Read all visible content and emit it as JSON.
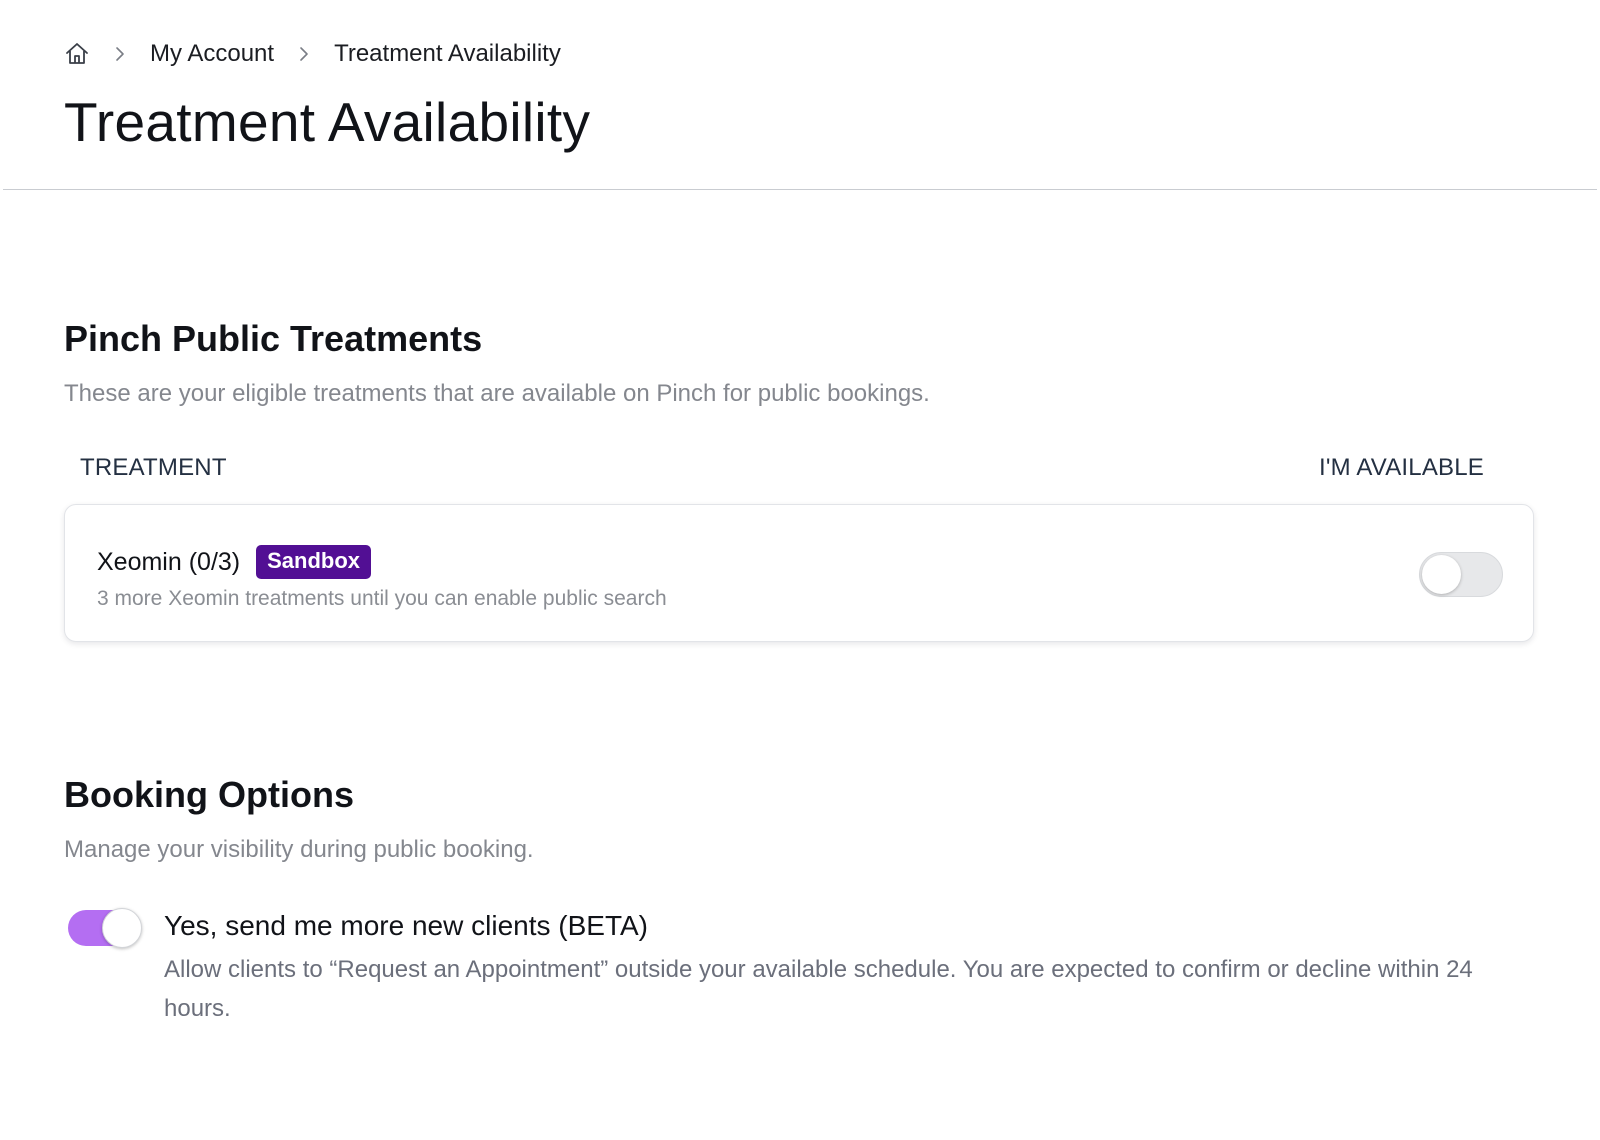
{
  "breadcrumb": {
    "home_icon": "home-icon",
    "separator_icon": "chevron-right-icon",
    "items": [
      {
        "label": "My Account"
      },
      {
        "label": "Treatment Availability"
      }
    ]
  },
  "page": {
    "title": "Treatment Availability"
  },
  "public_treatments": {
    "title": "Pinch Public Treatments",
    "subtitle": "These are your eligible treatments that are available on Pinch for public bookings.",
    "columns": {
      "treatment": "TREATMENT",
      "available": "I'M AVAILABLE"
    },
    "rows": [
      {
        "name": "Xeomin (0/3)",
        "badge": "Sandbox",
        "badge_color": "#520f94",
        "description": "3 more Xeomin treatments until you can enable public search",
        "available": false
      }
    ]
  },
  "booking_options": {
    "title": "Booking Options",
    "subtitle": "Manage your visibility during public booking.",
    "option": {
      "label": "Yes, send me more new clients (BETA)",
      "description": "Allow clients to “Request an Appointment” outside your available schedule. You are expected to confirm or decline within 24 hours.",
      "enabled": true,
      "accent_color": "#b46ef2"
    }
  }
}
